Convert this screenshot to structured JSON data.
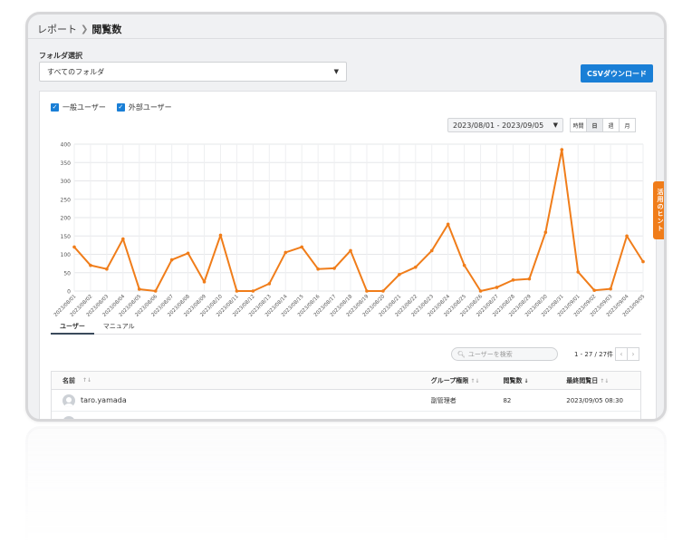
{
  "breadcrumb": {
    "parent": "レポート",
    "current": "閲覧数"
  },
  "folder": {
    "label": "フォルダ選択",
    "selected": "すべてのフォルダ"
  },
  "csv_button": "CSVダウンロード",
  "filters": {
    "general_users": "一般ユーザー",
    "external_users": "外部ユーザー"
  },
  "date_range": "2023/08/01 - 2023/09/05",
  "granularity": {
    "hour": "時間",
    "day": "日",
    "week": "週",
    "month": "月",
    "active": "日"
  },
  "hint_tab": "活用のヒント",
  "tabs": {
    "users": "ユーザー",
    "manual": "マニュアル"
  },
  "search": {
    "placeholder": "ユーザーを検索"
  },
  "pager": {
    "text": "1 - 27 / 27件",
    "prev": "‹",
    "next": "›"
  },
  "table": {
    "headers": {
      "name": "名前",
      "group": "グループ権限",
      "views": "閲覧数",
      "last": "最終閲覧日"
    },
    "rows": [
      {
        "name": "taro.yamada",
        "group": "副管理者",
        "views": "82",
        "last": "2023/09/05 08:30"
      }
    ]
  },
  "colors": {
    "accent": "#1a7fd6",
    "line": "#f07d1a",
    "hint": "#f07d1a"
  },
  "chart_data": {
    "type": "line",
    "title": "",
    "xlabel": "",
    "ylabel": "",
    "ylim": [
      0,
      400
    ],
    "yticks": [
      0,
      50,
      100,
      150,
      200,
      250,
      300,
      350,
      400
    ],
    "grid": true,
    "categories": [
      "2023/08/01",
      "2023/08/02",
      "2023/08/03",
      "2023/08/04",
      "2023/08/05",
      "2023/08/06",
      "2023/08/07",
      "2023/08/08",
      "2023/08/09",
      "2023/08/10",
      "2023/08/11",
      "2023/08/12",
      "2023/08/13",
      "2023/08/14",
      "2023/08/15",
      "2023/08/16",
      "2023/08/17",
      "2023/08/18",
      "2023/08/19",
      "2023/08/20",
      "2023/08/21",
      "2023/08/22",
      "2023/08/23",
      "2023/08/24",
      "2023/08/25",
      "2023/08/26",
      "2023/08/27",
      "2023/08/28",
      "2023/08/29",
      "2023/08/30",
      "2023/08/31",
      "2023/09/01",
      "2023/09/02",
      "2023/09/03",
      "2023/09/04",
      "2023/09/05"
    ],
    "series": [
      {
        "values": [
          120,
          70,
          60,
          142,
          5,
          0,
          85,
          103,
          25,
          152,
          0,
          0,
          20,
          105,
          120,
          60,
          62,
          110,
          0,
          0,
          45,
          65,
          110,
          182,
          70,
          0,
          10,
          30,
          33,
          160,
          385,
          52,
          2,
          6,
          150,
          80
        ]
      }
    ]
  }
}
